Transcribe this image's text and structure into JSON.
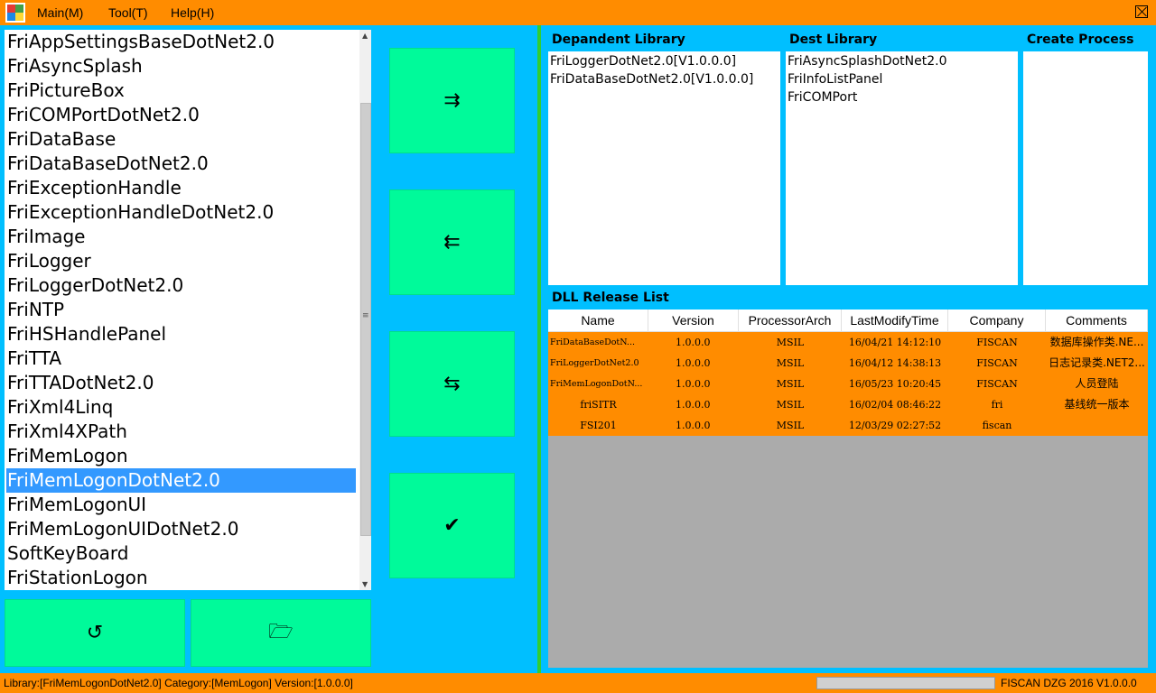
{
  "menu": {
    "main": "Main(M)",
    "tool": "Tool(T)",
    "help": "Help(H)"
  },
  "libraries": [
    "FriAppSettingsBaseDotNet2.0",
    "FriAsyncSplash",
    "FriPictureBox",
    "FriCOMPortDotNet2.0",
    "FriDataBase",
    "FriDataBaseDotNet2.0",
    "FriExceptionHandle",
    "FriExceptionHandleDotNet2.0",
    "FriImage",
    "FriLogger",
    "FriLoggerDotNet2.0",
    "FriNTP",
    "FriHSHandlePanel",
    "FriTTA",
    "FriTTADotNet2.0",
    "FriXml4Linq",
    "FriXml4XPath",
    "FriMemLogon",
    "FriMemLogonDotNet2.0",
    "FriMemLogonUI",
    "FriMemLogonUIDotNet2.0",
    "SoftKeyBoard",
    "FriStationLogon"
  ],
  "selected_library_index": 18,
  "buttons": {
    "add_icon": "⇉",
    "remove_icon": "⇇",
    "swap_icon": "⇆",
    "confirm_icon": "✔",
    "refresh_icon": "↺",
    "open_folder_icon": "🗁"
  },
  "dependent_library": {
    "label": "Depandent Library",
    "items": [
      "FriLoggerDotNet2.0[V1.0.0.0]",
      "FriDataBaseDotNet2.0[V1.0.0.0]"
    ]
  },
  "dest_library": {
    "label": "Dest Library",
    "items": [
      "FriAsyncSplashDotNet2.0",
      "FriInfoListPanel",
      "FriCOMPort"
    ]
  },
  "create_process": {
    "label": "Create Process",
    "items": []
  },
  "dll_release": {
    "label": "DLL Release List",
    "columns": [
      "Name",
      "Version",
      "ProcessorArch",
      "LastModifyTime",
      "Company",
      "Comments"
    ],
    "rows": [
      [
        "FriDataBaseDotN...",
        "1.0.0.0",
        "MSIL",
        "16/04/21 14:12:10",
        "FISCAN",
        "数据库操作类.NE..."
      ],
      [
        "FriLoggerDotNet2.0",
        "1.0.0.0",
        "MSIL",
        "16/04/12 14:38:13",
        "FISCAN",
        "日志记录类.NET2..."
      ],
      [
        "FriMemLogonDotN...",
        "1.0.0.0",
        "MSIL",
        "16/05/23 10:20:45",
        "FISCAN",
        "人员登陆"
      ],
      [
        "friSITR",
        "1.0.0.0",
        "MSIL",
        "16/02/04 08:46:22",
        "fri",
        "基线统一版本"
      ],
      [
        "FSI201",
        "1.0.0.0",
        "MSIL",
        "12/03/29 02:27:52",
        "fiscan",
        ""
      ]
    ]
  },
  "status": {
    "text": "Library:[FriMemLogonDotNet2.0] Category:[MemLogon] Version:[1.0.0.0]",
    "progress": 1.0,
    "version": "FISCAN DZG 2016 V1.0.0.0"
  },
  "colors": {
    "orange": "#FF8C00",
    "cyan": "#00BFFF",
    "green": "#00FA9A",
    "selection": "#3399FF",
    "grid_bg": "#ABABAB"
  }
}
